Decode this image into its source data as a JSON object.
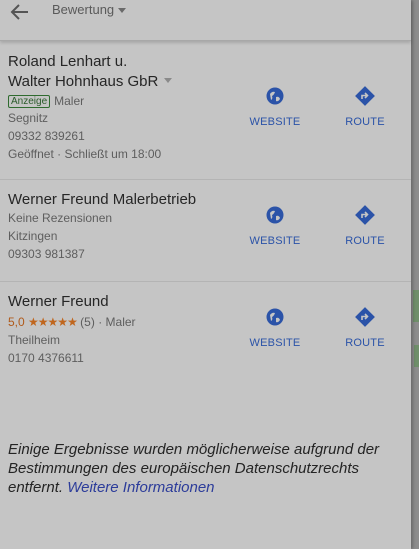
{
  "header": {
    "filter_label": "Bewertung"
  },
  "results": [
    {
      "name_line1": "Roland Lenhart u.",
      "name_line2": "Walter Hohnhaus GbR",
      "ad_label": "Anzeige",
      "category": "Maler",
      "location": "Segnitz",
      "phone": "09332 839261",
      "hours": "Geöffnet · Schließt um 18:00",
      "website_label": "WEBSITE",
      "route_label": "ROUTE"
    },
    {
      "name": "Werner Freund Malerbetrieb",
      "reviews": "Keine Rezensionen",
      "location": "Kitzingen",
      "phone": "09303 981387",
      "website_label": "WEBSITE",
      "route_label": "ROUTE"
    },
    {
      "name": "Werner Freund",
      "rating": "5,0",
      "stars_display": "★★★★★",
      "review_count": "(5)",
      "category_suffix": "· Maler",
      "location": "Theilheim",
      "phone": "0170 4376611",
      "website_label": "WEBSITE",
      "route_label": "ROUTE"
    }
  ],
  "notice": {
    "text": "Einige Ergebnisse wurden möglicherweise aufgrund der Bestimmungen des europäischen Datenschutzrechts entfernt.",
    "link": "Weitere Informationen"
  },
  "colors": {
    "accent": "#2b53a8",
    "rating": "#c0661e",
    "ad_badge": "#2f6b2f"
  },
  "icons": [
    "back-arrow-icon",
    "globe-icon",
    "directions-icon"
  ]
}
